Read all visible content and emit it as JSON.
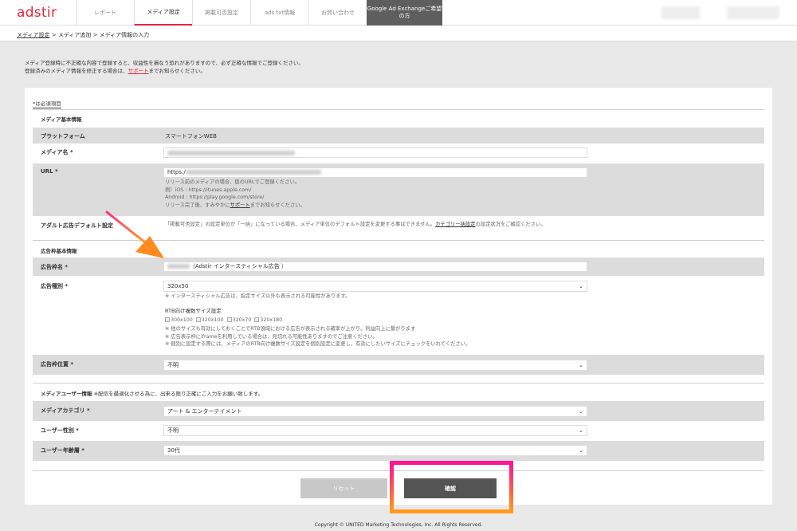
{
  "brand": {
    "logo": "adstir",
    "accent": "#e6233d"
  },
  "nav": [
    {
      "label": "レポート"
    },
    {
      "label": "メディア設定"
    },
    {
      "label": "掲載可否設定"
    },
    {
      "label": "ads.txt情報"
    },
    {
      "label": "お問い合わせ"
    },
    {
      "label": "Google Ad Exchangeご希望の方"
    }
  ],
  "breadcrumb": {
    "link": "メディア設定",
    "rest": " > メディア追加 > メディア情報の入力"
  },
  "notice": {
    "line1": "メディア登録時に不正確な内容で登録すると、収益性を損なう恐れがありますので、必ず正確な情報でご登録ください。",
    "line2_pre": "登録済みのメディア情報を修正する場合は、",
    "line2_link": "サポート",
    "line2_post": "までお知らせください。"
  },
  "required_note": "*は必須項目",
  "media_basic": {
    "title": "メディア基本情報",
    "platform_label": "プラットフォーム",
    "platform_value": "スマートフォンWEB",
    "name_label": "メディア名 *",
    "url_label": "URL *",
    "url_value": "https:/",
    "url_help1": "リリース前のメディアの場合、仮のURLでご登録ください。",
    "url_help2": "例）iOS : https://itunes.apple.com/",
    "url_help3": "Android : https://play.google.com/store/",
    "url_help4_pre": "リリース完了後、すみやかに",
    "url_help4_link": "サポート",
    "url_help4_post": "までお知らせください。",
    "adult_label": "アダルト広告デフォルト設定",
    "adult_pre": "「掲載可否設定」の設定単位が「一括」になっている場合、メディア単位のデフォルト設定を変更する事はできません。",
    "adult_link": "カテゴリー括設定",
    "adult_post": "の設定状況をご確認ください。"
  },
  "ad_basic": {
    "title": "広告枠基本情報",
    "name_label": "広告枠名 *",
    "name_value": "（Adstir インタースティシャル広告 ）",
    "type_label": "広告種別 *",
    "type_value": "320x50",
    "type_note": "※ インタースティシャル広告は、指定サイズ以外も表示される可能性があります。",
    "rtb_title": "RTB向け複数サイズ設定",
    "rtb_sizes": [
      "300x100",
      "320x100",
      "320x70",
      "320x180"
    ],
    "rtb_note1": "※ 他のサイズも有効にしておくことでRTB領域における広告が表示される確率が上がり、利益向上に繋がります",
    "rtb_note2": "※ 広告表示枠にiframeを利用している場合は、見切れる可能性ありますのでご注意ください。",
    "rtb_note3": "※ 個別に設定する際には、メディアのRTB向け複数サイズ設定を個別設定に変更し、有効にしたいサイズにチェックをいれてください。",
    "position_label": "広告枠位置 *",
    "position_value": "不明"
  },
  "media_user": {
    "title": "メディアユーザー情報",
    "title_note": "※配信を最適化させる為に、出来る限り正確にご入力をお願い致します。",
    "category_label": "メディアカテゴリ *",
    "category_value": "アート & エンターテイメント",
    "gender_label": "ユーザー性別 *",
    "gender_value": "不明",
    "age_label": "ユーザー年齢層 *",
    "age_value": "30代"
  },
  "buttons": {
    "reset": "リセット",
    "confirm": "確認"
  },
  "copyright": "Copyright © UNITED Marketing Technologies, Inc. All Rights Reserved.",
  "icons": {
    "select_chevron": "chevron-down-icon",
    "annotation_arrow": "arrow-icon",
    "highlight": "highlight-box"
  }
}
